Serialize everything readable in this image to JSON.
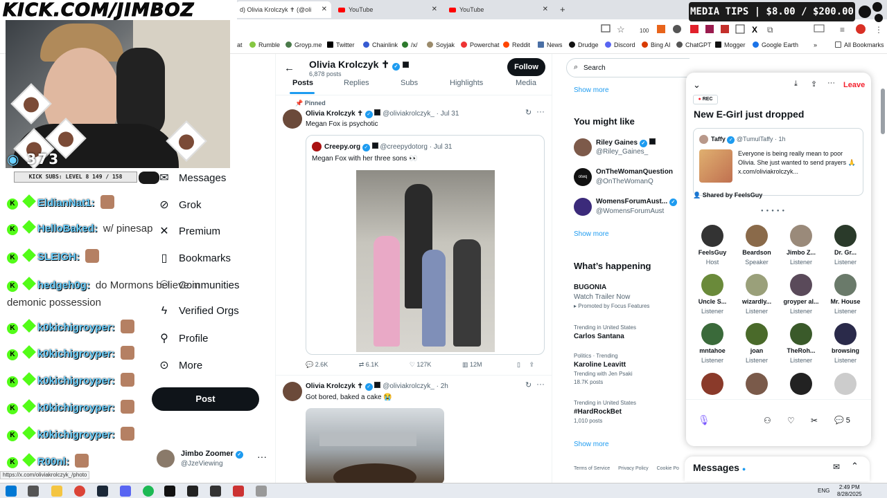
{
  "browser": {
    "tabs": [
      {
        "label": "d) Olivia Krolczyk ✝ (@oli",
        "active": true
      },
      {
        "label": "YouTube",
        "active": false
      },
      {
        "label": "YouTube",
        "active": false
      }
    ],
    "new_tab": "+",
    "bookmarks": [
      "at",
      "Rumble",
      "Groyp.me",
      "Twitter",
      "Chainlink",
      "/x/",
      "Soyjak",
      "Powerchat",
      "Reddit",
      "News",
      "Drudge",
      "Discord",
      "Bing AI",
      "ChatGPT",
      "Mogger",
      "Google Earth"
    ],
    "all_bookmarks": "All Bookmarks",
    "status_url": "https://x.com/oliviakrolczyk_/photo"
  },
  "overlay": {
    "logo": "KICK.COM/JIMBOZ",
    "viewers": "373",
    "kick_subs": "KICK SUBS: LEVEL 8 149 / 158",
    "media_tips": "MEDIA TIPS | $8.00 / $200.00"
  },
  "chat": [
    {
      "name": "EldianNat1:",
      "msg": ""
    },
    {
      "name": "HelloBaked:",
      "msg": "w/ pinesap"
    },
    {
      "name": "SLEIGH:",
      "msg": ""
    },
    {
      "name": "hedgeh0g:",
      "msg": "do Mormons believe in demonic possession"
    },
    {
      "name": "k0kichigroyper:",
      "msg": ""
    },
    {
      "name": "k0kichigroyper:",
      "msg": ""
    },
    {
      "name": "k0kichigroyper:",
      "msg": ""
    },
    {
      "name": "k0kichigroyper:",
      "msg": ""
    },
    {
      "name": "k0kichigroyper:",
      "msg": ""
    },
    {
      "name": "R00nl:",
      "msg": ""
    }
  ],
  "nav": {
    "items": [
      "Messages",
      "Grok",
      "Premium",
      "Bookmarks",
      "Communities",
      "Verified Orgs",
      "Profile",
      "More"
    ],
    "post": "Post",
    "account_name": "Jimbo Zoomer",
    "account_handle": "@JzeViewing"
  },
  "profile": {
    "name": "Olivia Krolczyk ✝",
    "posts_count": "6,878 posts",
    "follow": "Follow",
    "tabs": [
      "Posts",
      "Replies",
      "Subs",
      "Highlights",
      "Media"
    ]
  },
  "posts": [
    {
      "pinned": "Pinned",
      "name": "Olivia Krolczyk ✝",
      "handle": "@oliviakrolczyk_ · Jul 31",
      "text": "Megan Fox is psychotic",
      "quote": {
        "name": "Creepy.org",
        "handle": "@creepydotorg · Jul 31",
        "text": "Megan Fox with her three sons 👀"
      },
      "stats": {
        "replies": "2.6K",
        "reposts": "6.1K",
        "likes": "127K",
        "views": "12M"
      }
    },
    {
      "name": "Olivia Krolczyk ✝",
      "handle": "@oliviakrolczyk_ · 2h",
      "text": "Got bored, baked a cake 😭"
    }
  ],
  "right": {
    "search_placeholder": "Search",
    "show_more": "Show more",
    "you_might_like": "You might like",
    "suggestions": [
      {
        "name": "Riley Gaines",
        "handle": "@Riley_Gaines_",
        "color": "#7d5a4a"
      },
      {
        "name": "OnTheWomanQuestion",
        "handle": "@OnTheWomanQ",
        "color": "#111111"
      },
      {
        "name": "WomensForumAust...",
        "handle": "@WomensForumAust",
        "color": "#3b2a7a"
      }
    ],
    "whats_happening": "What’s happening",
    "trends": [
      {
        "meta": "",
        "title": "BUGONIA",
        "sub": "Watch Trailer Now",
        "extra": "Promoted by Focus Features"
      },
      {
        "meta": "Trending in United States",
        "title": "Carlos Santana",
        "sub": "",
        "extra": ""
      },
      {
        "meta": "Politics · Trending",
        "title": "Karoline Leavitt",
        "sub": "Trending with Jen Psaki",
        "extra": "18.7K posts"
      },
      {
        "meta": "Trending in United States",
        "title": "#HardRockBet",
        "sub": "1,010 posts",
        "extra": ""
      }
    ],
    "footer": [
      "Terms of Service",
      "Privacy Policy",
      "Cookie Po"
    ]
  },
  "space": {
    "leave": "Leave",
    "rec": "REC",
    "title": "New E-Girl just dropped",
    "shared_post": {
      "name": "Taffy",
      "handle": "@TumulTaffy · 1h",
      "text": "Everyone is being really mean to poor Olivia. She just wanted to send prayers 🙏 x.com/oliviakrolczyk..."
    },
    "shared_by": "Shared by FeelsGuy",
    "participants": [
      {
        "name": "FeelsGuy",
        "role": "Host"
      },
      {
        "name": "Beardson",
        "role": "Speaker"
      },
      {
        "name": "Jimbo Z...",
        "role": "Listener"
      },
      {
        "name": "Dr. Gr...",
        "role": "Listener"
      },
      {
        "name": "Uncle S...",
        "role": "Listener"
      },
      {
        "name": "wizardly...",
        "role": "Listener"
      },
      {
        "name": "groyper al...",
        "role": "Listener"
      },
      {
        "name": "Mr. House",
        "role": "Listener"
      },
      {
        "name": "mntahoe",
        "role": "Listener"
      },
      {
        "name": "joan",
        "role": "Listener"
      },
      {
        "name": "TheRoh...",
        "role": "Listener"
      },
      {
        "name": "browsing",
        "role": "Listener"
      }
    ],
    "comment_count": "5",
    "messages": "Messages"
  },
  "taskbar": {
    "lang": "ENG",
    "time": "2:49 PM",
    "date": "8/28/2025"
  },
  "colors": {
    "x_blue": "#1d9bf0",
    "kick_green": "#53fc18",
    "dark": "#0f1419"
  }
}
